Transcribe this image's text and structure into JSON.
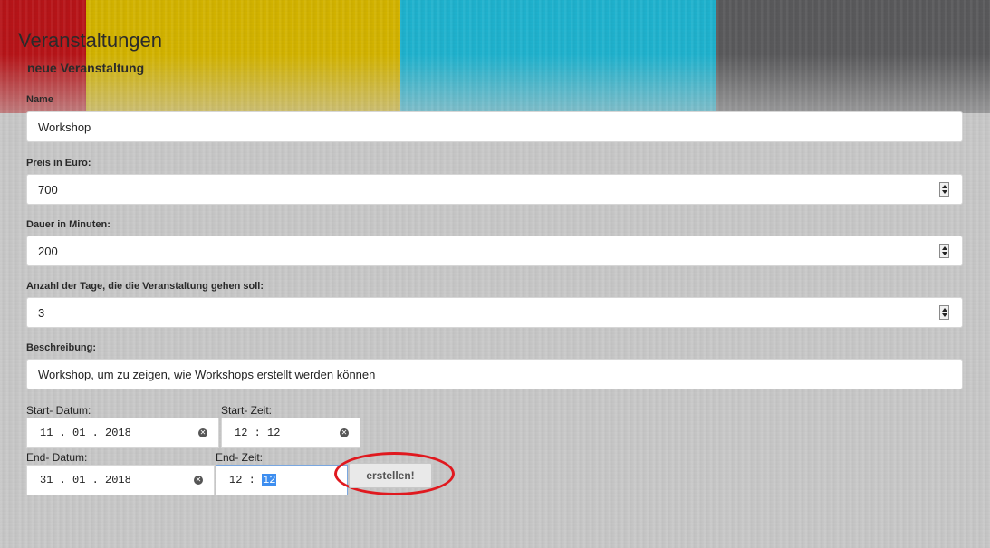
{
  "page": {
    "title": "Veranstaltungen",
    "section_title": "neue Veranstaltung"
  },
  "form": {
    "name": {
      "label": "Name",
      "value": "Workshop"
    },
    "price": {
      "label": "Preis in Euro:",
      "value": "700"
    },
    "duration": {
      "label": "Dauer in Minuten:",
      "value": "200"
    },
    "days": {
      "label": "Anzahl der Tage, die die Veranstaltung gehen soll:",
      "value": "3"
    },
    "description": {
      "label": "Beschreibung:",
      "value": "Workshop, um zu zeigen, wie Workshops erstellt werden können"
    },
    "start_date": {
      "label": "Start- Datum:",
      "value": "11 . 01 . 2018"
    },
    "start_time": {
      "label": "Start- Zeit:",
      "value": "12 : 12"
    },
    "end_date": {
      "label": "End- Datum:",
      "value": "31 . 01 . 2018"
    },
    "end_time": {
      "label": "End- Zeit:",
      "hours": "12",
      "separator": " : ",
      "minutes_selected": "12"
    },
    "submit_label": "erstellen!"
  },
  "icons": {
    "clear": "clear-circle-x-icon",
    "spinner": "number-spinner-icon"
  },
  "colors": {
    "band_red": "#b81418",
    "band_yellow": "#d4b400",
    "band_cyan": "#1fb3cf",
    "band_dark": "#5a5a5c",
    "highlight_ellipse": "#e0191f",
    "selection": "#3d8ef0"
  }
}
